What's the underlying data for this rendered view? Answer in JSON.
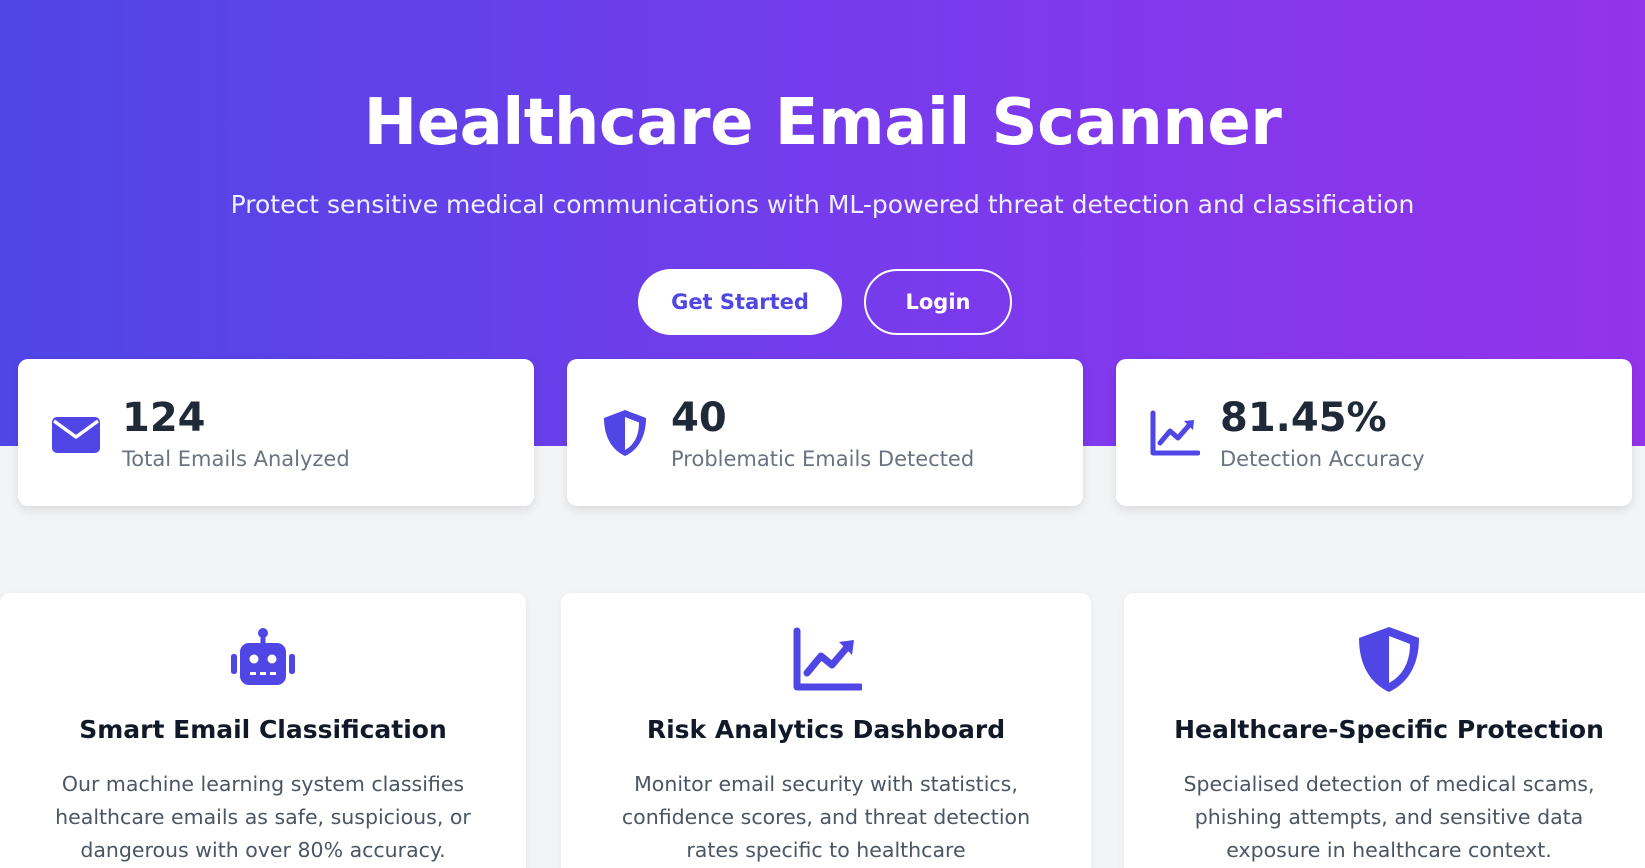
{
  "hero": {
    "title": "Healthcare Email Scanner",
    "subtitle": "Protect sensitive medical communications with ML-powered threat detection and classification",
    "primary_button": "Get Started",
    "secondary_button": "Login"
  },
  "stats": [
    {
      "value": "124",
      "label": "Total Emails Analyzed",
      "icon": "envelope-icon"
    },
    {
      "value": "40",
      "label": "Problematic Emails Detected",
      "icon": "shield-icon"
    },
    {
      "value": "81.45%",
      "label": "Detection Accuracy",
      "icon": "chart-line-icon"
    }
  ],
  "features": [
    {
      "title": "Smart Email Classification",
      "description": "Our machine learning system classifies healthcare emails as safe, suspicious, or dangerous with over 80% accuracy.",
      "icon": "robot-icon"
    },
    {
      "title": "Risk Analytics Dashboard",
      "description": "Monitor email security with statistics, confidence scores, and threat detection rates specific to healthcare communications.",
      "icon": "chart-line-icon"
    },
    {
      "title": "Healthcare-Specific Protection",
      "description": "Specialised detection of medical scams, phishing attempts, and sensitive data exposure in healthcare context.",
      "icon": "shield-icon"
    }
  ],
  "colors": {
    "accent": "#4f46e5",
    "gradient_start": "#4f46e5",
    "gradient_end": "#9333ea",
    "page_background": "#f3f4f6"
  }
}
